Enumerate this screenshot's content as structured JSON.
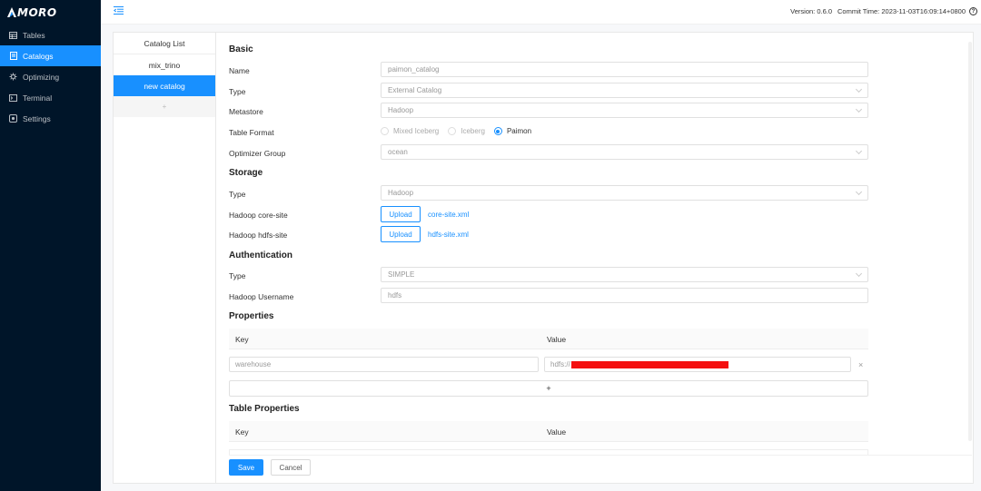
{
  "app": {
    "logo_text": "MORO"
  },
  "sidebar": {
    "items": [
      {
        "label": "Tables",
        "icon": "table-icon"
      },
      {
        "label": "Catalogs",
        "icon": "catalog-icon",
        "active": true
      },
      {
        "label": "Optimizing",
        "icon": "optimizing-icon"
      },
      {
        "label": "Terminal",
        "icon": "terminal-icon"
      },
      {
        "label": "Settings",
        "icon": "settings-icon"
      }
    ]
  },
  "header": {
    "version_label": "Version: 0.6.0",
    "commit_label": "Commit Time: 2023-11-03T16:09:14+0800",
    "help_glyph": "?"
  },
  "catalog_list": {
    "title": "Catalog List",
    "items": [
      "mix_trino",
      "new catalog"
    ],
    "add_label": "+"
  },
  "form": {
    "basic": {
      "title": "Basic",
      "name_label": "Name",
      "name_value": "paimon_catalog",
      "type_label": "Type",
      "type_value": "External Catalog",
      "metastore_label": "Metastore",
      "metastore_value": "Hadoop",
      "table_format_label": "Table Format",
      "table_format_options": [
        "Mixed Iceberg",
        "Iceberg",
        "Paimon"
      ],
      "table_format_selected": "Paimon",
      "optimizer_group_label": "Optimizer Group",
      "optimizer_group_value": "ocean"
    },
    "storage": {
      "title": "Storage",
      "type_label": "Type",
      "type_value": "Hadoop",
      "core_site_label": "Hadoop core-site",
      "core_site_button": "Upload",
      "core_site_file": "core-site.xml",
      "hdfs_site_label": "Hadoop hdfs-site",
      "hdfs_site_button": "Upload",
      "hdfs_site_file": "hdfs-site.xml"
    },
    "authentication": {
      "title": "Authentication",
      "type_label": "Type",
      "type_value": "SIMPLE",
      "username_label": "Hadoop Username",
      "username_value": "hdfs"
    },
    "properties": {
      "title": "Properties",
      "key_header": "Key",
      "value_header": "Value",
      "rows": [
        {
          "key": "warehouse",
          "value_prefix": "hdfs://"
        }
      ],
      "delete_glyph": "×",
      "add_label": "+"
    },
    "table_properties": {
      "title": "Table Properties",
      "key_header": "Key",
      "value_header": "Value"
    },
    "actions": {
      "save_label": "Save",
      "cancel_label": "Cancel"
    }
  },
  "colors": {
    "sidebar_bg": "#001529",
    "accent": "#1890ff",
    "redaction": "#f41010"
  }
}
